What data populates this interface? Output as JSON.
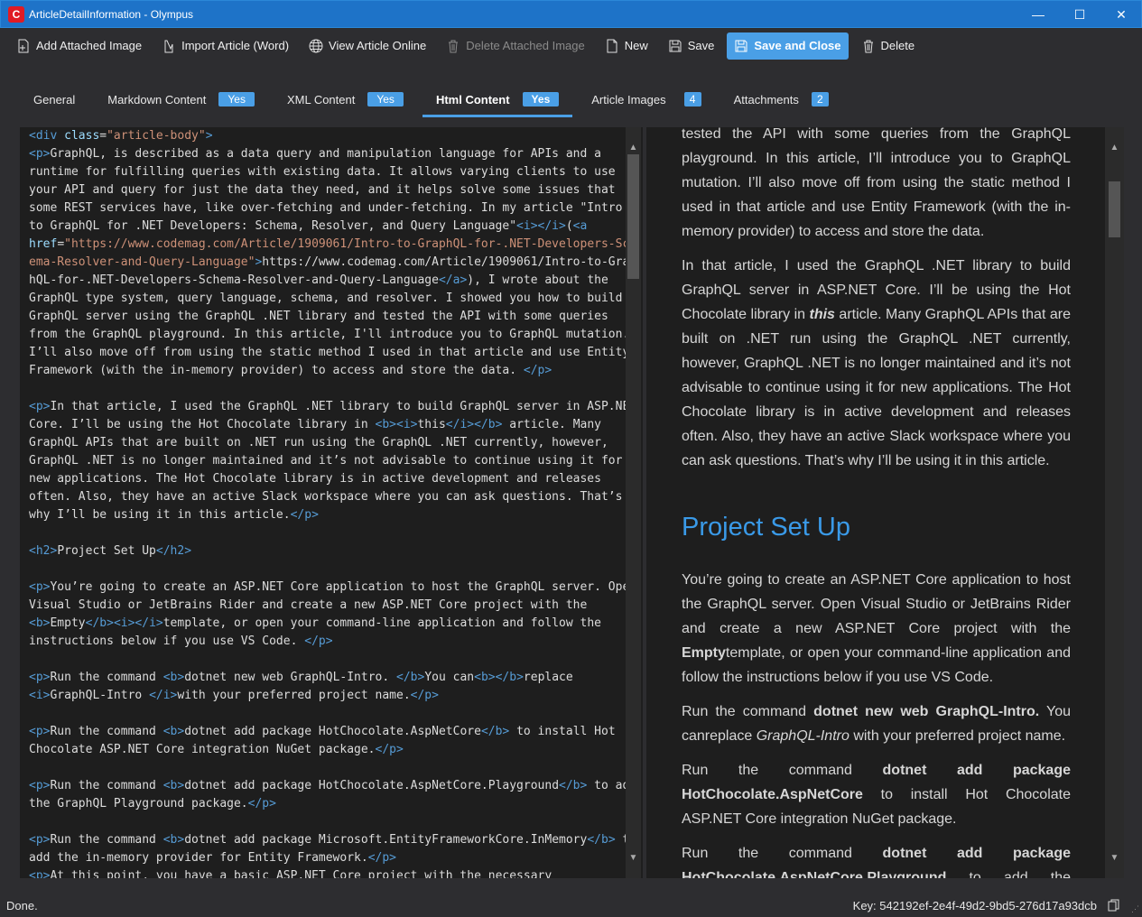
{
  "window": {
    "title": "ArticleDetailInformation - Olympus",
    "app_icon": "C",
    "minimize_glyph": "—",
    "maximize_glyph": "☐",
    "close_glyph": "✕"
  },
  "toolbar": {
    "add_image": {
      "icon": "add-image-icon",
      "label": "Add Attached Image"
    },
    "import_article": {
      "icon": "import-icon",
      "label": "Import Article (Word)"
    },
    "view_online": {
      "icon": "globe-icon",
      "label": "View Article Online"
    },
    "delete_image": {
      "icon": "trash-icon",
      "label": "Delete Attached Image"
    },
    "new": {
      "icon": "new-document-icon",
      "label": "New"
    },
    "save": {
      "icon": "save-icon",
      "label": "Save"
    },
    "save_close": {
      "icon": "save-icon",
      "label": "Save and Close"
    },
    "delete": {
      "icon": "trash-icon",
      "label": "Delete"
    }
  },
  "tabs": [
    {
      "label": "General",
      "badge": ""
    },
    {
      "label": "Markdown Content",
      "badge": "Yes"
    },
    {
      "label": "XML Content",
      "badge": "Yes"
    },
    {
      "label": "Html Content",
      "badge": "Yes",
      "active": true
    },
    {
      "label": "Article Images",
      "badge": "4"
    },
    {
      "label": "Attachments",
      "badge": "2"
    }
  ],
  "code_lines": [
    "<div class=\"article-body\">",
    "<p>GraphQL, is described as a data query and manipulation language for APIs and a",
    "runtime for fulfilling queries with existing data. It allows varying clients to use",
    "your API and query for just the data they need, and it helps solve some issues that",
    "some REST services have, like over-fetching and under-fetching. In my article \"Intro",
    "to GraphQL for .NET Developers: Schema, Resolver, and Query Language\"<i></i>(<a",
    "href=\"https://www.codemag.com/Article/1909061/Intro-to-GraphQL-for-.NET-Developers-Sch",
    "ema-Resolver-and-Query-Language\">https://www.codemag.com/Article/1909061/Intro-to-Grap",
    "hQL-for-.NET-Developers-Schema-Resolver-and-Query-Language</a>), I wrote about the",
    "GraphQL type system, query language, schema, and resolver. I showed you how to build a",
    "GraphQL server using the GraphQL .NET library and tested the API with some queries",
    "from the GraphQL playground. In this article, I'll introduce you to GraphQL mutation.",
    "I’ll also move off from using the static method I used in that article and use Entity",
    "Framework (with the in-memory provider) to access and store the data. </p>",
    "",
    "<p>In that article, I used the GraphQL .NET library to build GraphQL server in ASP.NET",
    "Core. I’ll be using the Hot Chocolate library in <b><i>this</i></b> article. Many",
    "GraphQL APIs that are built on .NET run using the GraphQL .NET currently, however,",
    "GraphQL .NET is no longer maintained and it’s not advisable to continue using it for",
    "new applications. The Hot Chocolate library is in active development and releases",
    "often. Also, they have an active Slack workspace where you can ask questions. That’s",
    "why I’ll be using it in this article.</p>",
    "",
    "<h2>Project Set Up</h2>",
    "",
    "<p>You’re going to create an ASP.NET Core application to host the GraphQL server. Open",
    "Visual Studio or JetBrains Rider and create a new ASP.NET Core project with the",
    "<b>Empty</b><i></i>template, or open your command-line application and follow the",
    "instructions below if you use VS Code. </p>",
    "",
    "<p>Run the command <b>dotnet new web GraphQL-Intro. </b>You can<b></b>replace",
    "<i>GraphQL-Intro </i>with your preferred project name.</p>",
    "",
    "<p>Run the command <b>dotnet add package HotChocolate.AspNetCore</b> to install Hot",
    "Chocolate ASP.NET Core integration NuGet package.</p>",
    "",
    "<p>Run the command <b>dotnet add package HotChocolate.AspNetCore.Playground</b> to add",
    "the GraphQL Playground package.</p>",
    "",
    "<p>Run the command <b>dotnet add package Microsoft.EntityFrameworkCore.InMemory</b> to",
    "add the in-memory provider for Entity Framework.</p>",
    "<p>At this point, you have a basic ASP.NET Core project with the necessary"
  ],
  "preview": {
    "p1": "tested the API with some queries from the GraphQL playground. In this article, I’ll introduce you to GraphQL mutation. I’ll also move off from using the static method I used in that article and use Entity Framework (with the in-memory provider) to access and store the data.",
    "p2a": "In that article, I used the GraphQL .NET library to build GraphQL server in ASP.NET Core. I’ll be using the Hot Chocolate library in ",
    "p2b": "this",
    "p2c": " article. Many GraphQL APIs that are built on .NET run using the GraphQL .NET currently, however, GraphQL .NET is no longer maintained and it’s not advisable to continue using it for new applications. The Hot Chocolate library is in active development and releases often. Also, they have an active Slack workspace where you can ask questions. That’s why I’ll be using it in this article.",
    "h2": "Project Set Up",
    "p3a": "You’re going to create an ASP.NET Core application to host the GraphQL server. Open Visual Studio or JetBrains Rider and create a new ASP.NET Core project with the ",
    "p3b": "Empty",
    "p3c": "template, or open your command-line application and follow the instructions below if you use VS Code.",
    "p4a": "Run the command ",
    "p4b": "dotnet new web GraphQL-Intro.",
    "p4c": " You canreplace ",
    "p4d": "GraphQL-Intro",
    "p4e": " with your preferred project name.",
    "p5a": "Run the command ",
    "p5b": "dotnet add package HotChocolate.AspNetCore",
    "p5c": " to install Hot Chocolate ASP.NET Core integration NuGet package.",
    "p6a": "Run the command ",
    "p6b": "dotnet add package HotChocolate.AspNetCore.Playground",
    "p6c": " to add the GraphQL Playground package."
  },
  "status": {
    "text": "Done.",
    "key": "Key: 542192ef-2e4f-49d2-9bd5-276d17a93dcb"
  },
  "colors": {
    "accent": "#4a9fe6",
    "titlebar": "#1e73c8",
    "heading": "#3a9ae8",
    "tag": "#569cd6",
    "attribute": "#9cdcfe",
    "string": "#ce9178"
  }
}
